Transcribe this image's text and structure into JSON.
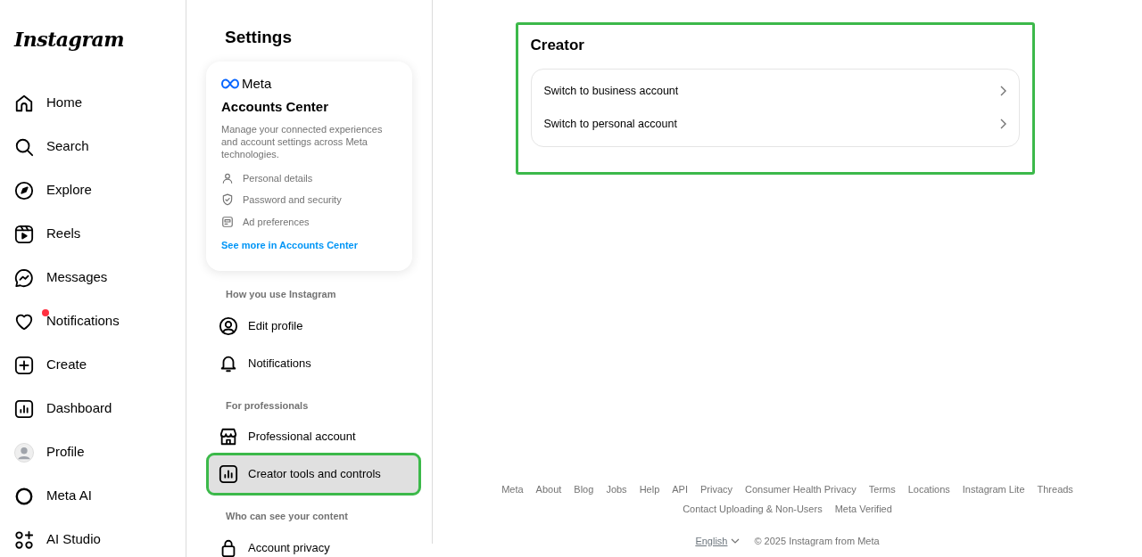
{
  "logo": "Instagram",
  "nav": [
    {
      "label": "Home",
      "selected": false
    },
    {
      "label": "Search",
      "selected": false
    },
    {
      "label": "Explore",
      "selected": false
    },
    {
      "label": "Reels",
      "selected": false
    },
    {
      "label": "Messages",
      "selected": false
    },
    {
      "label": "Notifications",
      "selected": false,
      "unread": true
    },
    {
      "label": "Create",
      "selected": false
    },
    {
      "label": "Dashboard",
      "selected": false
    },
    {
      "label": "Profile",
      "selected": false
    },
    {
      "label": "Meta AI",
      "selected": false
    },
    {
      "label": "AI Studio",
      "selected": false
    }
  ],
  "settings": {
    "title": "Settings",
    "accounts_center": {
      "brand": "Meta",
      "title": "Accounts Center",
      "description": "Manage your connected experiences and account settings across Meta technologies.",
      "items": [
        "Personal details",
        "Password and security",
        "Ad preferences"
      ],
      "link": "See more in Accounts Center"
    },
    "sections": [
      {
        "heading": "How you use Instagram",
        "items": [
          {
            "label": "Edit profile",
            "selected": false,
            "highlighted": false
          },
          {
            "label": "Notifications",
            "selected": false,
            "highlighted": false
          }
        ]
      },
      {
        "heading": "For professionals",
        "items": [
          {
            "label": "Professional account",
            "selected": false,
            "highlighted": false
          },
          {
            "label": "Creator tools and controls",
            "selected": true,
            "highlighted": true
          }
        ]
      },
      {
        "heading": "Who can see your content",
        "items": [
          {
            "label": "Account privacy",
            "selected": false,
            "highlighted": false
          }
        ]
      }
    ]
  },
  "content": {
    "title": "Creator",
    "highlighted": true,
    "options": [
      "Switch to business account",
      "Switch to personal account"
    ]
  },
  "footer": {
    "links": [
      "Meta",
      "About",
      "Blog",
      "Jobs",
      "Help",
      "API",
      "Privacy",
      "Consumer Health Privacy",
      "Terms",
      "Locations",
      "Instagram Lite",
      "Threads",
      "Contact Uploading & Non-Users",
      "Meta Verified"
    ],
    "language": "English",
    "copyright": "© 2025 Instagram from Meta"
  }
}
